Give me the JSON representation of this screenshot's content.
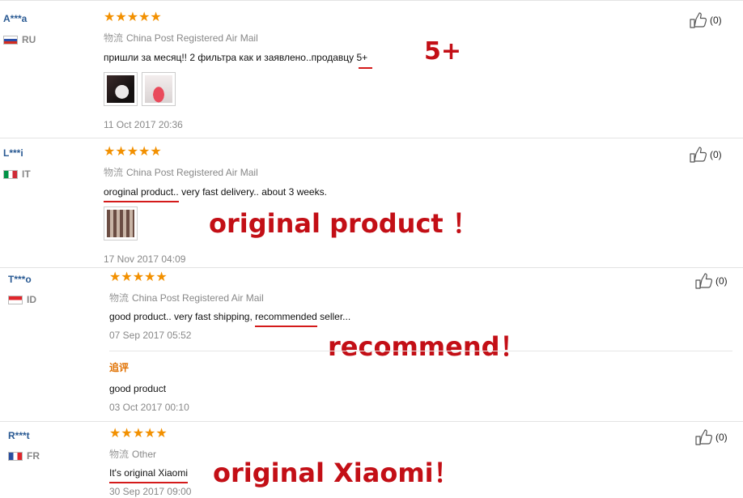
{
  "reviews": [
    {
      "user": "A***a",
      "country": "RU",
      "stars": "★★★★★",
      "logistics_label": "物流",
      "logistics": "China Post Registered Air Mail",
      "comment_text": "пришли за месяц!! 2 фильтра как и заявлено..продавцу ",
      "comment_mark": "5+",
      "date": "11 Oct 2017 20:36",
      "helpful_count": "(0)",
      "annotation": "5+"
    },
    {
      "user": "L***i",
      "country": "IT",
      "stars": "★★★★★",
      "logistics_label": "物流",
      "logistics": "China Post Registered Air Mail",
      "comment_mark": "oroginal product..",
      "comment_rest": " very fast delivery.. about 3 weeks.",
      "date": "17 Nov 2017 04:09",
      "helpful_count": "(0)",
      "annotation": "original product ！"
    },
    {
      "user": "T***o",
      "country": "ID",
      "stars": "★★★★★",
      "logistics_label": "物流",
      "logistics": "China Post Registered Air Mail",
      "comment_pre": "good product.. very fast shipping, ",
      "comment_mark": "recommended",
      "comment_post": " seller...",
      "date": "07 Sep 2017 05:52",
      "followup_label": "追评",
      "followup_text": "good product",
      "followup_date": "03 Oct 2017 00:10",
      "helpful_count": "(0)",
      "annotation": "recommend！"
    },
    {
      "user": "R***t",
      "country": "FR",
      "stars": "★★★★★",
      "logistics_label": "物流",
      "logistics": "Other",
      "comment_mark": "It's original Xiaomi",
      "date": "30 Sep 2017 09:00",
      "helpful_count": "(0)",
      "annotation": "original Xiaomi！"
    }
  ],
  "colors": {
    "star": "#f29000",
    "username": "#2a5a93",
    "annotation": "#c30f16",
    "underline": "#d41a1a"
  },
  "icons": {
    "helpful": "thumbs-up-icon",
    "star": "star-icon"
  }
}
